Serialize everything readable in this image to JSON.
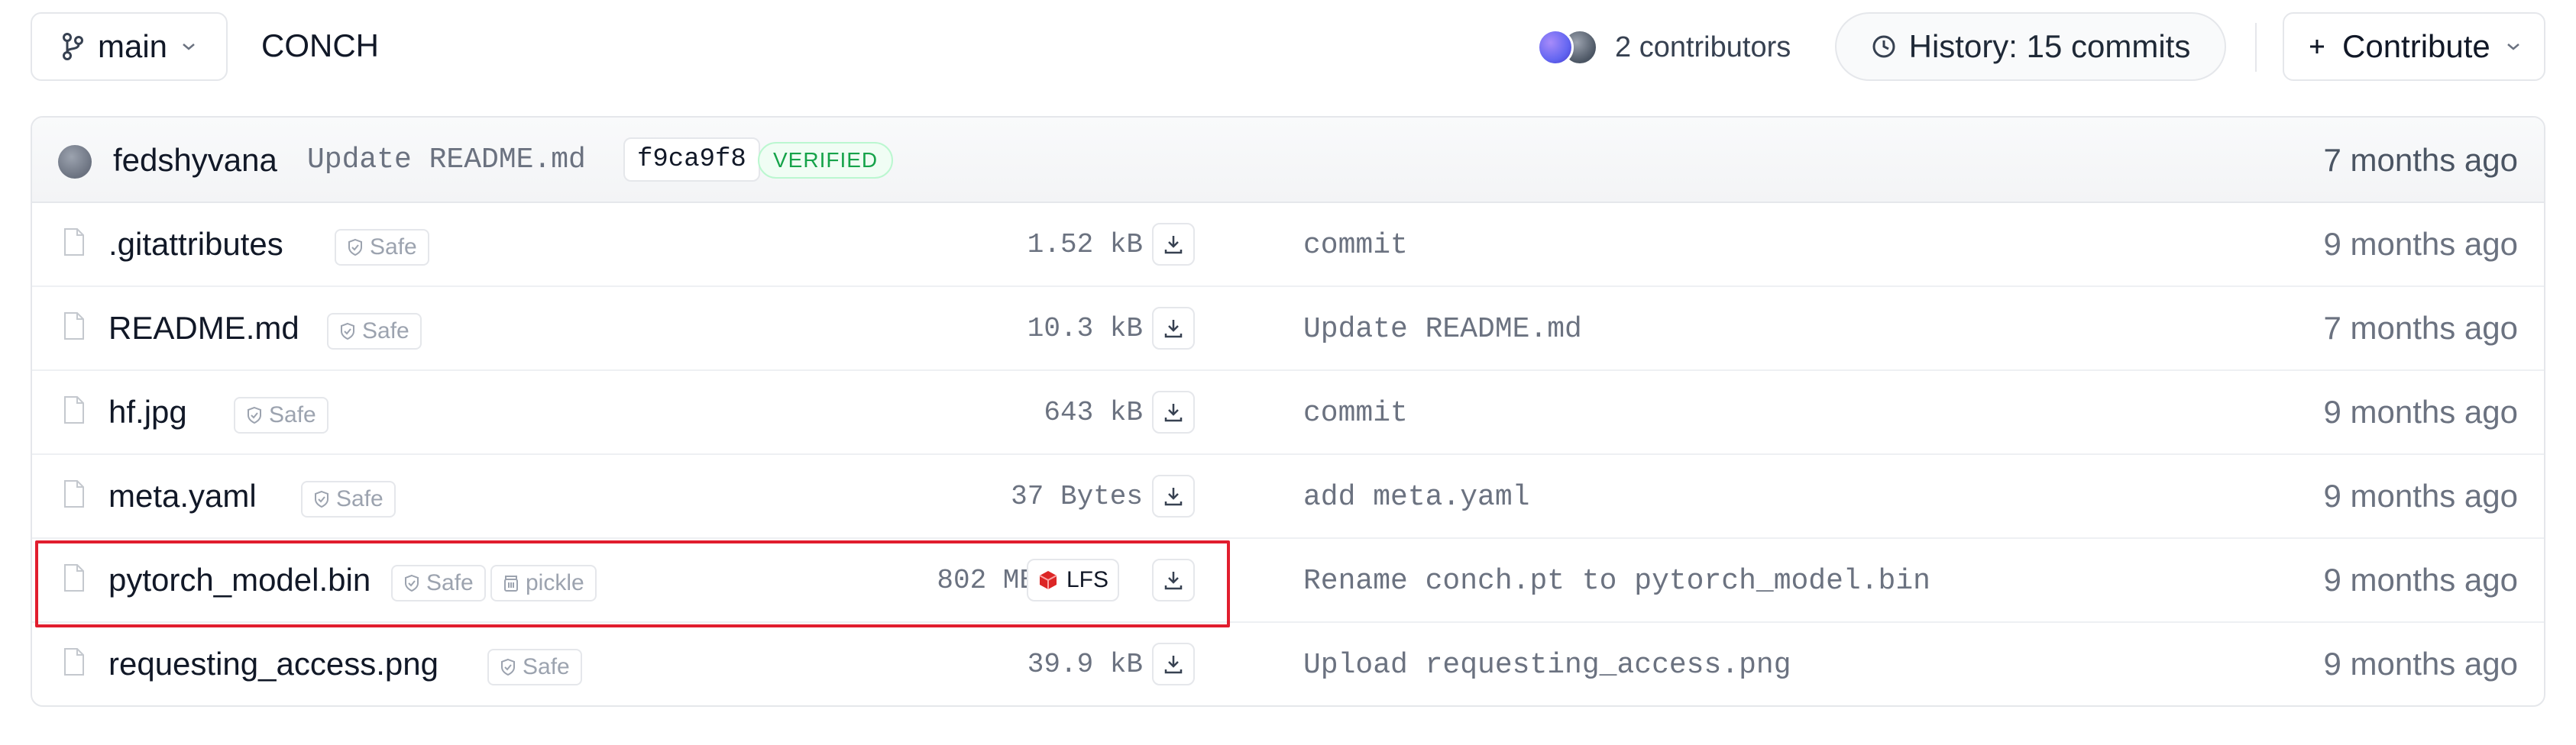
{
  "header": {
    "branch": "main",
    "repo_name": "CONCH",
    "contributors": "2 contributors",
    "history": "History: 15 commits",
    "contribute": "Contribute"
  },
  "last_commit": {
    "author": "fedshyvana",
    "message": "Update README.md",
    "sha": "f9ca9f8",
    "verified": "VERIFIED",
    "date": "7 months ago"
  },
  "files": [
    {
      "name": ".gitattributes",
      "safe": "Safe",
      "size": "1.52 kB",
      "message": "commit",
      "date": "9 months ago"
    },
    {
      "name": "README.md",
      "safe": "Safe",
      "size": "10.3 kB",
      "message": "Update README.md",
      "date": "7 months ago"
    },
    {
      "name": "hf.jpg",
      "safe": "Safe",
      "size": "643 kB",
      "message": "commit",
      "date": "9 months ago"
    },
    {
      "name": "meta.yaml",
      "safe": "Safe",
      "size": "37 Bytes",
      "message": "add meta.yaml",
      "date": "9 months ago"
    },
    {
      "name": "pytorch_model.bin",
      "safe": "Safe",
      "pickle": "pickle",
      "size": "802 MB",
      "lfs": "LFS",
      "message": "Rename conch.pt to pytorch_model.bin",
      "date": "9 months ago"
    },
    {
      "name": "requesting_access.png",
      "safe": "Safe",
      "size": "39.9 kB",
      "message": "Upload requesting_access.png",
      "date": "9 months ago"
    }
  ],
  "colors": {
    "verified_green": "#16a34a",
    "highlight_red": "#e11d2e",
    "lfs_red": "#dc2626"
  }
}
